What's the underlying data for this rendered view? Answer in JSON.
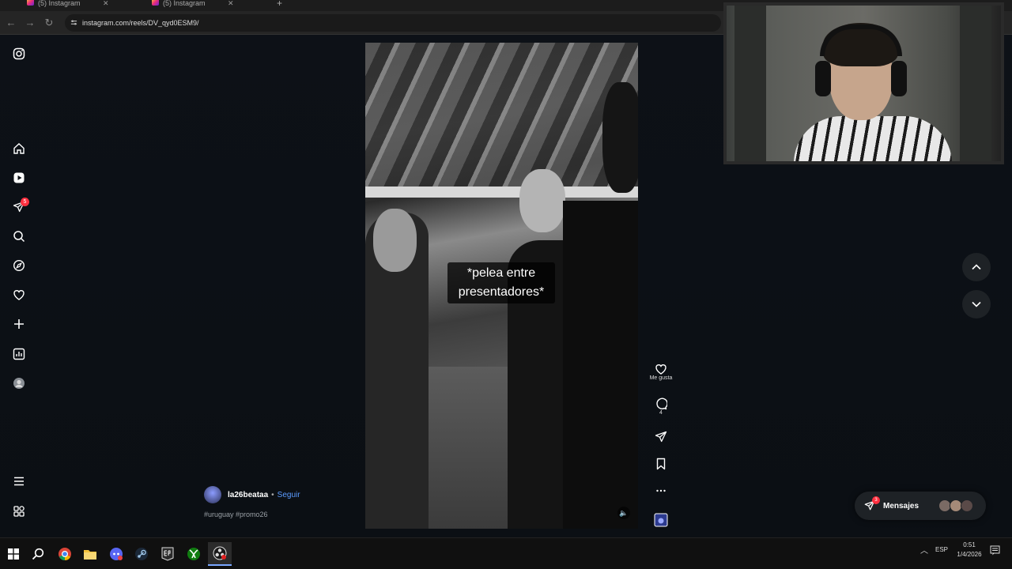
{
  "browser": {
    "tabs": [
      {
        "title": "(5) Instagram"
      },
      {
        "title": "(5) Instagram"
      }
    ],
    "url": "instagram.com/reels/DV_qyd0ESM9/"
  },
  "sidebar": {
    "notification_count": "5",
    "items": [
      "instagram-logo",
      "home",
      "reels",
      "messages",
      "search",
      "explore",
      "notifications",
      "create",
      "dashboard",
      "profile",
      "more",
      "also-from-meta"
    ]
  },
  "reel": {
    "caption": "*pelea entre presentadores*",
    "author": "la26beataa",
    "separator": "•",
    "follow_label": "Seguir",
    "hashtags": "#uruguay #promo26"
  },
  "actions": {
    "like_label": "Me gusta",
    "comment_count": "4"
  },
  "messages": {
    "label": "Mensajes",
    "badge": "3"
  },
  "taskbar": {
    "language": "ESP",
    "time": "0:51",
    "date": "1/4/2026"
  },
  "colors": {
    "page_bg": "#0d1117",
    "accent_link": "#5b9bff",
    "badge": "#ff3040"
  }
}
